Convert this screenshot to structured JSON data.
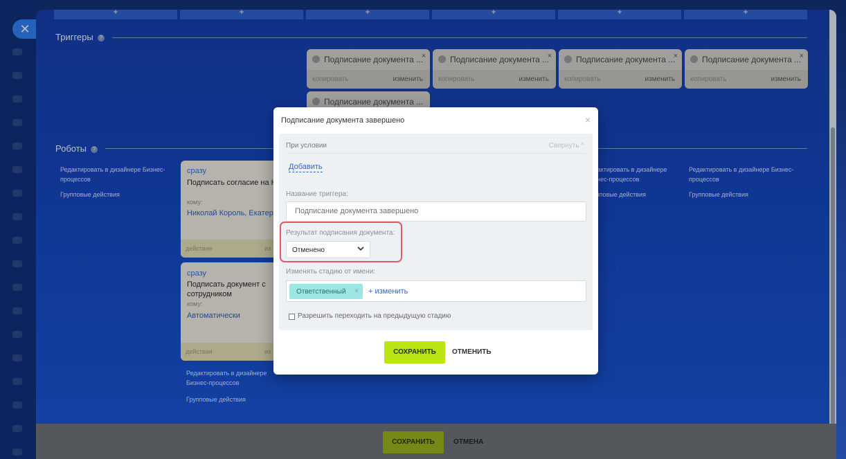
{
  "icons": {
    "close": "close-icon",
    "help": "help-icon",
    "plus": "plus-icon",
    "chevron": "chevron-down-icon",
    "edit": "pencil-icon"
  },
  "slider": {
    "close_symbol": "✕"
  },
  "columns": {
    "plus_symbol": "+"
  },
  "triggers": {
    "title": "Триггеры",
    "help": "?",
    "cards": [
      {
        "label": "Подписание документа ...",
        "copy": "копировать",
        "edit": "изменить",
        "close": "×"
      },
      {
        "label": "Подписание документа ...",
        "copy": "копировать",
        "edit": "изменить",
        "close": "×"
      },
      {
        "label": "Подписание документа ...",
        "copy": "копировать",
        "edit": "изменить",
        "close": "×"
      },
      {
        "label": "Подписание документа ...",
        "copy": "копировать",
        "edit": "изменить",
        "close": "×"
      },
      {
        "label": "Подписание документа ..."
      }
    ]
  },
  "robots": {
    "title": "Роботы",
    "help": "?",
    "designer_link": "Редактировать в дизайнере Бизнес-процессов",
    "group_actions": "Групповые действия",
    "cards": [
      {
        "when": "сразу",
        "name": "Подписать согласие на К",
        "to_label": "кому:",
        "value": "Николай Король, Екатер",
        "footer_left": "действия",
        "footer_right": "из"
      },
      {
        "when": "сразу",
        "name": "Подписать документ с сотрудником",
        "to_label": "кому:",
        "value": "Автоматически",
        "footer_left": "действия",
        "footer_right": "из"
      }
    ]
  },
  "bottom_bar": {
    "save": "СОХРАНИТЬ",
    "cancel": "ОТМЕНА"
  },
  "modal": {
    "title": "Подписание документа завершено",
    "close": "×",
    "condition_label": "При условии",
    "collapse_label": "Свернуть ^",
    "add_link": "Добавить",
    "trigger_name_label": "Название триггера:",
    "trigger_name_value": "Подписание документа завершено",
    "result_label": "Результат подписания документа:",
    "result_value": "Отменено",
    "change_stage_label": "Изменять стадию от имени:",
    "responsible_tag": "Ответственный",
    "tag_remove": "×",
    "change_link": "+ изменить",
    "allow_prev_label": "Разрешить переходить на предыдущую стадию",
    "allow_prev_checked": false,
    "save": "СОХРАНИТЬ",
    "cancel": "ОТМЕНИТЬ"
  }
}
